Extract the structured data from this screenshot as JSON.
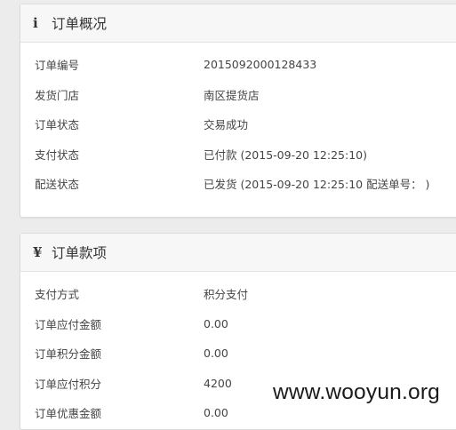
{
  "order_overview": {
    "icon": "info-icon",
    "icon_glyph": "i",
    "title": "订单概况",
    "rows": [
      {
        "label": "订单编号",
        "value": "2015092000128433"
      },
      {
        "label": "发货门店",
        "value": "南区提货店"
      },
      {
        "label": "订单状态",
        "value": "交易成功"
      },
      {
        "label": "支付状态",
        "value": "已付款 (2015-09-20 12:25:10)"
      },
      {
        "label": "配送状态",
        "value": "已发货 (2015-09-20 12:25:10 配送单号： )"
      }
    ]
  },
  "order_payment": {
    "icon": "yen-icon",
    "icon_glyph": "¥",
    "title": "订单款项",
    "rows": [
      {
        "label": "支付方式",
        "value": "积分支付"
      },
      {
        "label": "订单应付金额",
        "value": "0.00"
      },
      {
        "label": "订单积分金额",
        "value": "0.00"
      },
      {
        "label": "订单应付积分",
        "value": "4200"
      },
      {
        "label": "订单优惠金额",
        "value": "0.00"
      }
    ]
  },
  "watermark": "www.wooyun.org"
}
